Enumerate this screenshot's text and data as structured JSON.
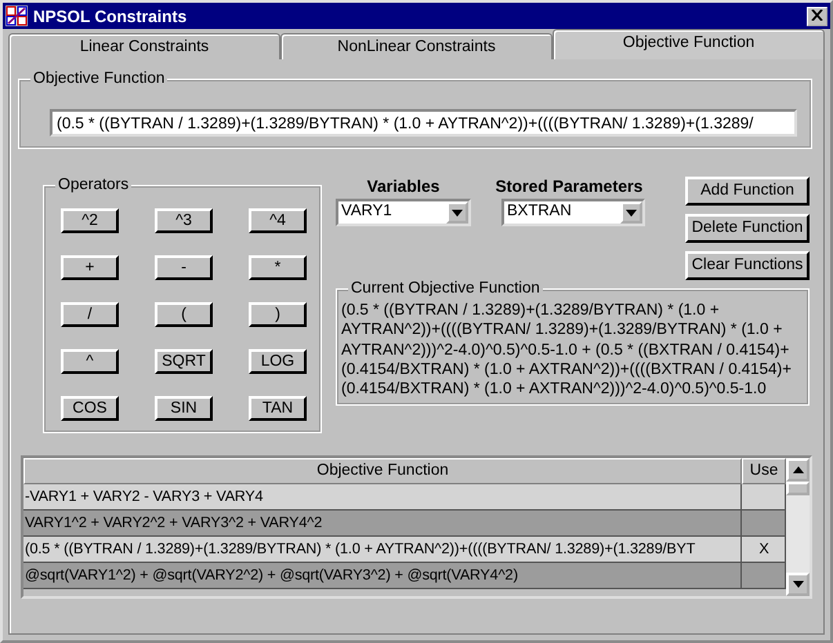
{
  "window": {
    "title": "NPSOL Constraints"
  },
  "tabs": [
    {
      "label": "Linear Constraints",
      "selected": false
    },
    {
      "label": "NonLinear Constraints",
      "selected": false
    },
    {
      "label": "Objective Function",
      "selected": true
    }
  ],
  "objective_function": {
    "legend": "Objective Function",
    "value": "(0.5 * ((BYTRAN / 1.3289)+(1.3289/BYTRAN) * (1.0 + AYTRAN^2))+((((BYTRAN/ 1.3289)+(1.3289/"
  },
  "operators": {
    "legend": "Operators",
    "buttons": [
      "^2",
      "^3",
      "^4",
      "+",
      "-",
      "*",
      "/",
      "(",
      ")",
      "^",
      "SQRT",
      "LOG",
      "COS",
      "SIN",
      "TAN"
    ]
  },
  "variables": {
    "label": "Variables",
    "value": "VARY1"
  },
  "stored_parameters": {
    "label": "Stored Parameters",
    "value": "BXTRAN"
  },
  "actions": [
    "Add Function",
    "Delete Function",
    "Clear Functions"
  ],
  "current_objective": {
    "legend": "Current Objective Function",
    "text": "(0.5 * ((BYTRAN / 1.3289)+(1.3289/BYTRAN) * (1.0 + AYTRAN^2))+((((BYTRAN/ 1.3289)+(1.3289/BYTRAN) * (1.0 + AYTRAN^2)))^2-4.0)^0.5)^0.5-1.0 + (0.5 * ((BXTRAN / 0.4154)+(0.4154/BXTRAN) * (1.0 + AXTRAN^2))+((((BXTRAN / 0.4154)+(0.4154/BXTRAN) * (1.0 + AXTRAN^2)))^2-4.0)^0.5)^0.5-1.0"
  },
  "table": {
    "columns": [
      "Objective Function",
      "Use"
    ],
    "rows": [
      {
        "function": "-VARY1 + VARY2 - VARY3 + VARY4",
        "use": ""
      },
      {
        "function": "VARY1^2 + VARY2^2 + VARY3^2 + VARY4^2",
        "use": ""
      },
      {
        "function": "(0.5 * ((BYTRAN / 1.3289)+(1.3289/BYTRAN) * (1.0 + AYTRAN^2))+((((BYTRAN/ 1.3289)+(1.3289/BYT",
        "use": "X"
      },
      {
        "function": "@sqrt(VARY1^2) + @sqrt(VARY2^2) + @sqrt(VARY3^2) + @sqrt(VARY4^2)",
        "use": ""
      }
    ]
  }
}
